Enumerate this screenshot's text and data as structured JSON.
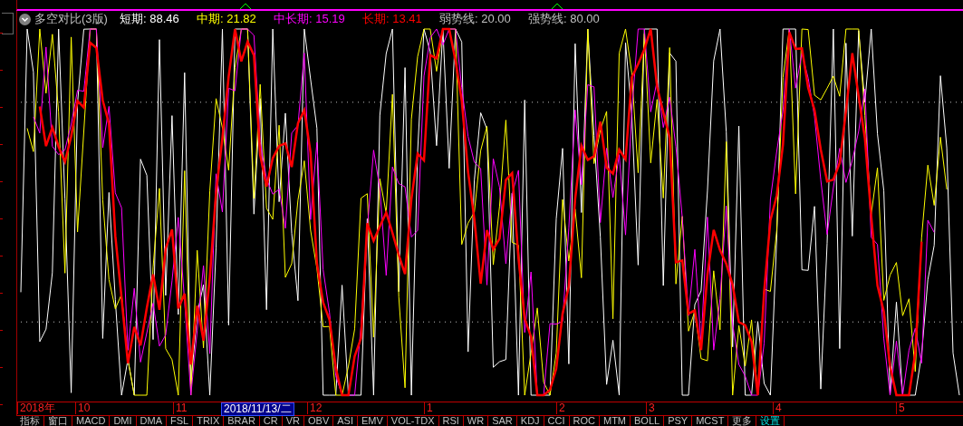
{
  "indicator": {
    "title": "多空对比(3版)",
    "items": [
      {
        "label": "短期:",
        "value": "88.46",
        "color": "#ffffff"
      },
      {
        "label": "中期:",
        "value": "21.82",
        "color": "#ffff00"
      },
      {
        "label": "中长期:",
        "value": "15.19",
        "color": "#ff00ff"
      },
      {
        "label": "长期:",
        "value": "13.41",
        "color": "#ff0000"
      },
      {
        "label": "弱势线:",
        "value": "20.00",
        "color": "#c0c0c0"
      },
      {
        "label": "强势线:",
        "value": "80.00",
        "color": "#c0c0c0"
      }
    ]
  },
  "time_axis": {
    "labels": [
      {
        "text": "2018年",
        "selected": false
      },
      {
        "text": "10",
        "selected": false
      },
      {
        "text": "11",
        "selected": false
      },
      {
        "text": "2018/11/13/二",
        "selected": true
      },
      {
        "text": "12",
        "selected": false
      },
      {
        "text": "1",
        "selected": false
      },
      {
        "text": "2",
        "selected": false
      },
      {
        "text": "3",
        "selected": false
      },
      {
        "text": "4",
        "selected": false
      },
      {
        "text": "5",
        "selected": false
      }
    ]
  },
  "tabs": [
    {
      "label": "指标",
      "kind": "indicator"
    },
    {
      "label": "窗口",
      "kind": "indicator"
    },
    {
      "label": "MACD",
      "kind": "indicator"
    },
    {
      "label": "DMI",
      "kind": "indicator"
    },
    {
      "label": "DMA",
      "kind": "indicator"
    },
    {
      "label": "FSL",
      "kind": "indicator"
    },
    {
      "label": "TRIX",
      "kind": "indicator"
    },
    {
      "label": "BRAR",
      "kind": "indicator"
    },
    {
      "label": "CR",
      "kind": "indicator"
    },
    {
      "label": "VR",
      "kind": "indicator"
    },
    {
      "label": "OBV",
      "kind": "indicator"
    },
    {
      "label": "ASI",
      "kind": "indicator"
    },
    {
      "label": "EMV",
      "kind": "indicator"
    },
    {
      "label": "VOL-TDX",
      "kind": "indicator"
    },
    {
      "label": "RSI",
      "kind": "indicator"
    },
    {
      "label": "WR",
      "kind": "indicator"
    },
    {
      "label": "SAR",
      "kind": "indicator"
    },
    {
      "label": "KDJ",
      "kind": "indicator"
    },
    {
      "label": "CCI",
      "kind": "indicator"
    },
    {
      "label": "ROC",
      "kind": "indicator"
    },
    {
      "label": "MTM",
      "kind": "indicator"
    },
    {
      "label": "BOLL",
      "kind": "indicator"
    },
    {
      "label": "PSY",
      "kind": "indicator"
    },
    {
      "label": "MCST",
      "kind": "indicator"
    },
    {
      "label": "更多",
      "kind": "indicator"
    },
    {
      "label": "设置",
      "kind": "settings"
    }
  ]
}
